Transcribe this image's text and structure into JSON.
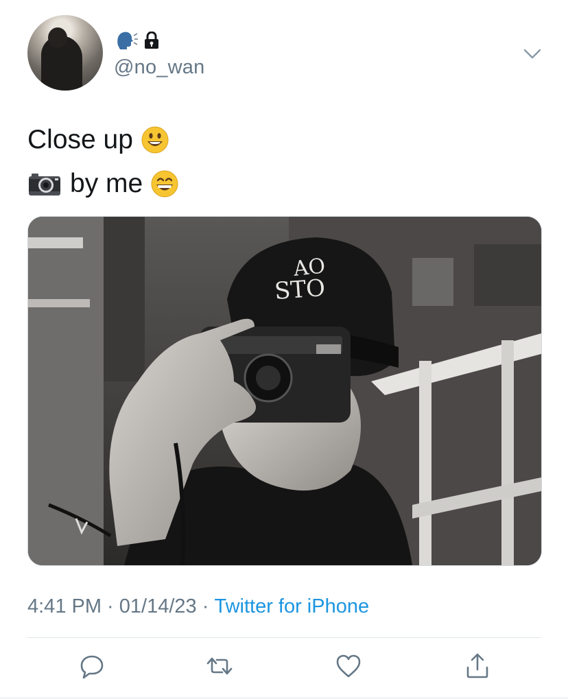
{
  "user": {
    "name_emojis": [
      "speaking-head-icon",
      "lock-icon"
    ],
    "handle": "@no_wan",
    "avatar": "avatar-photo"
  },
  "tweet": {
    "line1_text": "Close up",
    "line1_emoji": "smiling-face-icon",
    "line2_emoji": "camera-icon",
    "line2_text": "by me",
    "line2_emoji_end": "grinning-face-icon"
  },
  "media": {
    "description": "",
    "hat_text": "AO STO"
  },
  "meta": {
    "time": "4:41 PM",
    "sep1": " · ",
    "date": "01/14/23",
    "sep2": " · ",
    "source": "Twitter for iPhone"
  },
  "actions": {
    "reply": "reply-icon",
    "retweet": "retweet-icon",
    "like": "heart-icon",
    "share": "share-icon"
  },
  "colors": {
    "link": "#1b95e0",
    "muted": "#657786",
    "text": "#14171a"
  }
}
